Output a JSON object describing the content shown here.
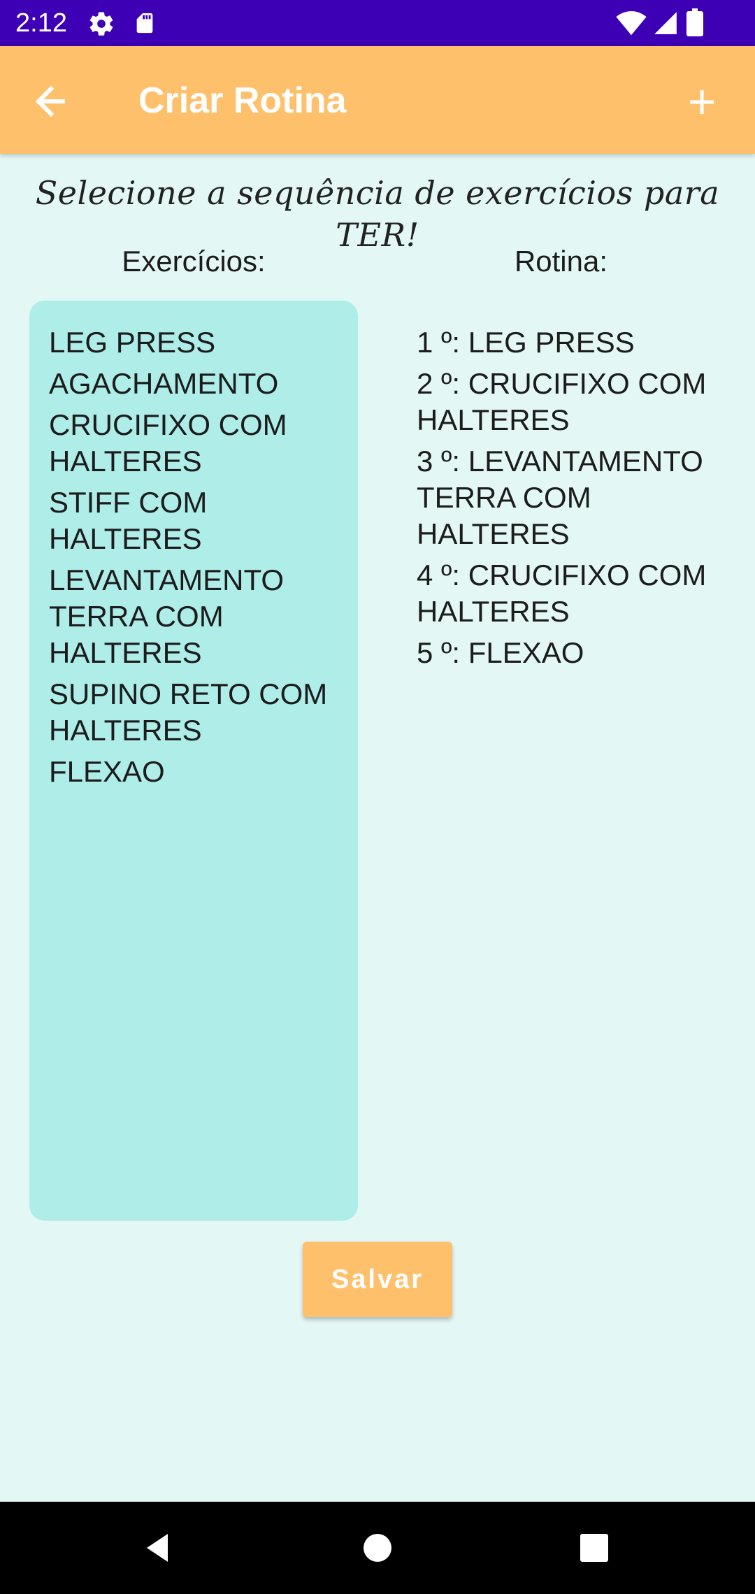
{
  "status_bar": {
    "time": "2:12",
    "icons": [
      "gear-icon",
      "sd-card-icon",
      "wifi-icon",
      "signal-icon",
      "battery-icon"
    ]
  },
  "app_bar": {
    "title": "Criar Rotina",
    "back_icon": "arrow-left-icon",
    "add_icon": "plus-icon",
    "background_color": "#FFC06C"
  },
  "prompt": "Selecione a sequência de exercícios para TER!",
  "exercises": {
    "heading": "Exercícios:",
    "items": [
      "LEG PRESS",
      "AGACHAMENTO",
      "CRUCIFIXO COM HALTERES",
      "STIFF COM HALTERES",
      "LEVANTAMENTO TERRA COM HALTERES",
      "SUPINO RETO COM HALTERES",
      "FLEXAO"
    ],
    "box_color": "#AEEDE8"
  },
  "routine": {
    "heading": "Rotina:",
    "items": [
      "1 º: LEG PRESS",
      "2 º: CRUCIFIXO COM HALTERES",
      "3 º: LEVANTAMENTO TERRA COM HALTERES",
      "4 º: CRUCIFIXO COM HALTERES",
      "5 º: FLEXAO"
    ]
  },
  "save_button": {
    "label": "Salvar"
  },
  "nav_bar": {
    "icons": [
      "nav-back-icon",
      "nav-home-icon",
      "nav-recents-icon"
    ]
  },
  "colors": {
    "status_bar": "#3D00B4",
    "background": "#E3F7F5",
    "accent": "#FFC06C"
  }
}
